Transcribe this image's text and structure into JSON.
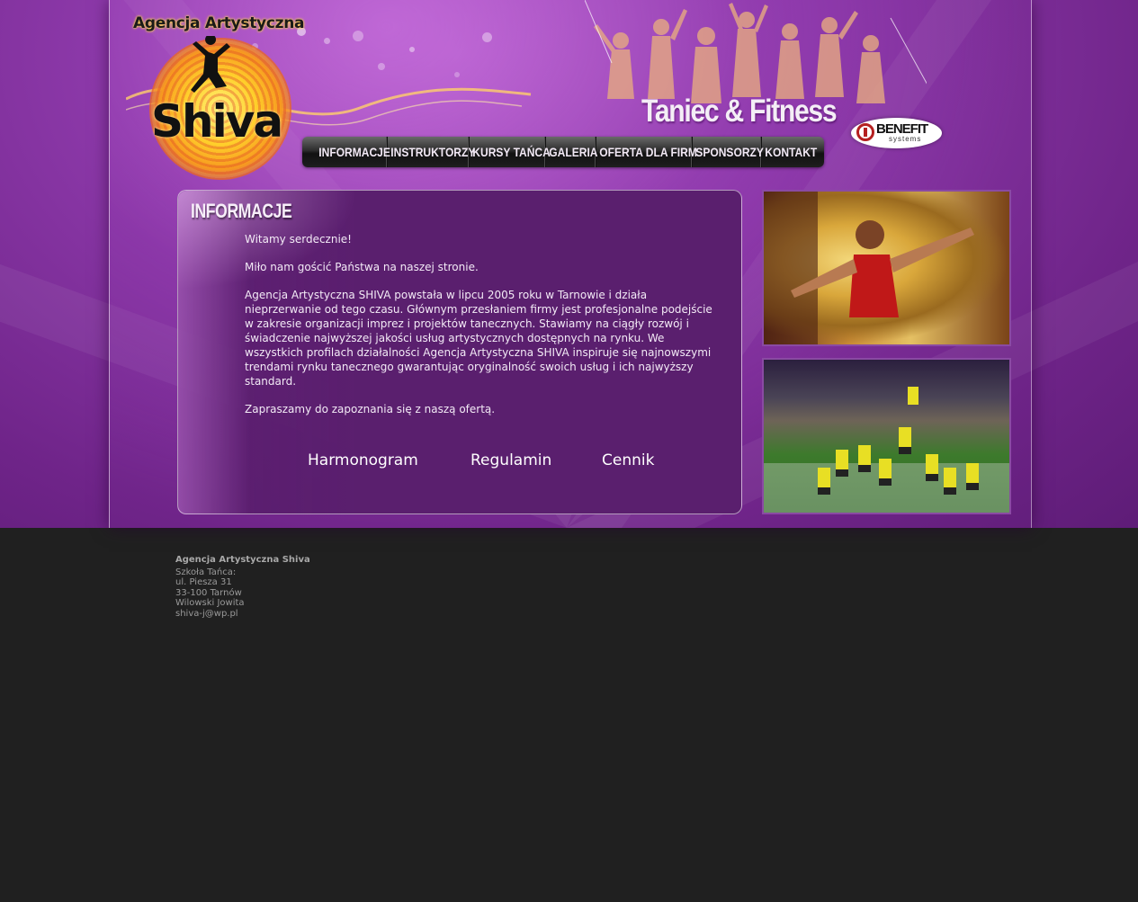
{
  "header": {
    "logo_top_text": "Agencja Artystyczna",
    "logo_main_text": "Shiva",
    "tagline": "Taniec & Fitness",
    "partner_logo": {
      "name": "BENEFIT",
      "sub": "systems"
    }
  },
  "nav": {
    "items": [
      {
        "label": "INFORMACJE"
      },
      {
        "label": "INSTRUKTORZY"
      },
      {
        "label": "KURSY TAŃCA"
      },
      {
        "label": "GALERIA"
      },
      {
        "label": "OFERTA DLA FIRM"
      },
      {
        "label": "SPONSORZY"
      },
      {
        "label": "KONTAKT"
      }
    ]
  },
  "content": {
    "title": "INFORMACJE",
    "paragraphs": [
      "Witamy serdecznie!",
      "Miło nam gościć Państwa na naszej stronie.",
      "Agencja Artystyczna SHIVA powstała w lipcu 2005 roku w Tarnowie i działa nieprzerwanie od tego czasu. Głównym przesłaniem firmy jest profesjonalne podejście w zakresie organizacji imprez i projektów tanecznych. Stawiamy na ciągły rozwój i świadczenie najwyższej jakości usług artystycznych dostępnych na rynku. We wszystkich profilach działalności Agencja Artystyczna SHIVA inspiruje się najnowszymi trendami rynku tanecznego gwarantując oryginalność swoich usług i ich najwyższy standard.",
      "Zapraszamy do zapoznania się z naszą ofertą."
    ],
    "links": [
      {
        "label": "Harmonogram"
      },
      {
        "label": "Regulamin"
      },
      {
        "label": "Cennik"
      }
    ]
  },
  "footer": {
    "company": "Agencja Artystyczna Shiva",
    "lines": [
      "Szkoła Tańca:",
      "ul. Piesza 31",
      "33-100 Tarnów",
      "Wilowski Jowita",
      "shiva-j@wp.pl"
    ]
  },
  "colors": {
    "brand_purple": "#8e3aab",
    "content_bg": "#5a1f6e",
    "footer_bg": "#202020",
    "logo_yellow": "#ffd02b"
  }
}
